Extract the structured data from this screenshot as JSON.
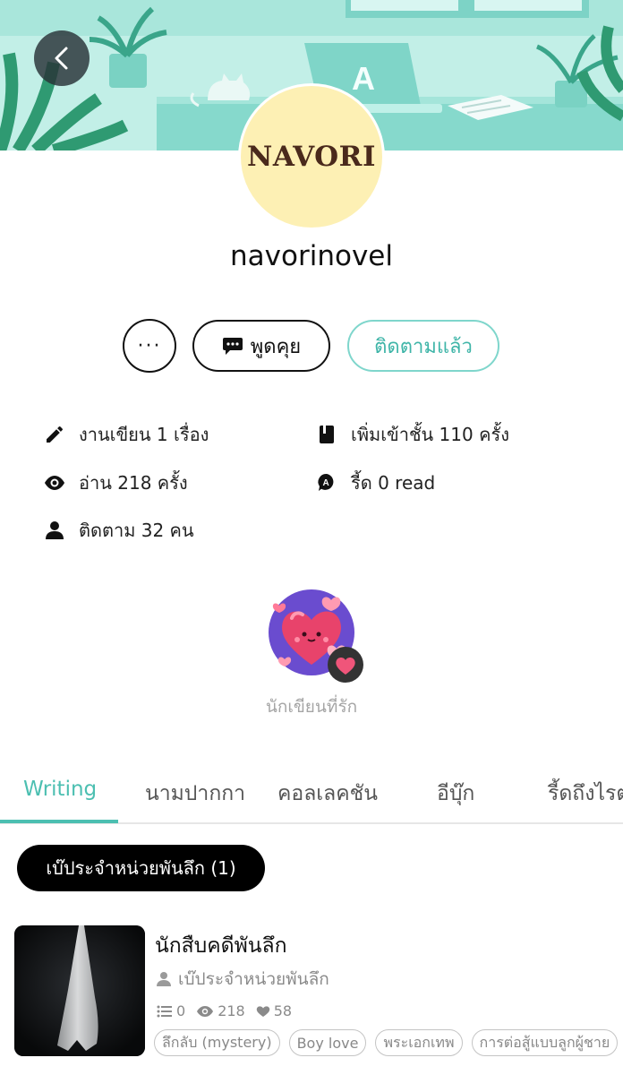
{
  "header": {
    "back_icon": "chevron-left-icon"
  },
  "profile": {
    "avatar_text": "NAVORI",
    "username": "navorinovel",
    "avatar_bg": "#fdf0b4",
    "avatar_text_color": "#4a2a1c"
  },
  "actions": {
    "more_label": "···",
    "chat_label": "พูดคุย",
    "follow_label": "ติดตามแล้ว",
    "accent": "#4cbfb1"
  },
  "stats": [
    {
      "icon": "pencil-icon",
      "text": "งานเขียน 1 เรื่อง"
    },
    {
      "icon": "book-icon",
      "text": "เพิ่มเข้าชั้น 110 ครั้ง"
    },
    {
      "icon": "eye-icon",
      "text": "อ่าน 218 ครั้ง"
    },
    {
      "icon": "read-badge-icon",
      "text": "รี้ด 0 read"
    },
    {
      "icon": "person-icon",
      "text": "ติดตาม 32 คน"
    }
  ],
  "badge": {
    "label": "นักเขียนที่รัก",
    "icon": "heart-badge-icon"
  },
  "tabs": [
    {
      "label": "Writing",
      "active": true
    },
    {
      "label": "นามปากกา",
      "active": false
    },
    {
      "label": "คอลเลคชัน",
      "active": false
    },
    {
      "label": "อีบุ๊ก",
      "active": false
    },
    {
      "label": "รี้ดถึงไรต",
      "active": false
    }
  ],
  "pen_name_pill": "เบ๊ประจำหน่วยพันลึก (1)",
  "novel": {
    "title": "นักสืบคดีพันลึก",
    "author": "เบ๊ประจำหน่วยพันลึก",
    "chapters": "0",
    "views": "218",
    "likes": "58",
    "tags": [
      "ลึกลับ (mystery)",
      "Boy love",
      "พระเอกเทพ",
      "การต่อสู้แบบลูกผู้ชาย"
    ]
  }
}
